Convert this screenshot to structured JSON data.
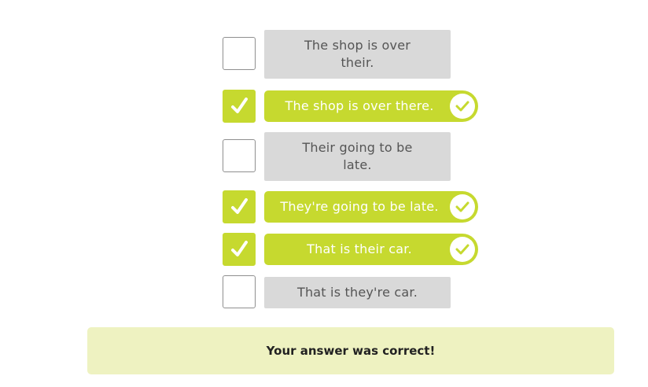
{
  "options": [
    {
      "label": "The shop is over their.",
      "checked": false
    },
    {
      "label": "The shop is over there.",
      "checked": true
    },
    {
      "label": "Their going to be late.",
      "checked": false
    },
    {
      "label": "They're going to be late.",
      "checked": true
    },
    {
      "label": "That is their car.",
      "checked": true
    },
    {
      "label": "That is they're car.",
      "checked": false
    }
  ],
  "feedback": {
    "message": "Your answer was correct!"
  },
  "colors": {
    "accent": "#c6d92f",
    "option_bg": "#d9d9d9",
    "option_text": "#555555",
    "feedback_bg": "#eef2c1"
  },
  "icons": {
    "checkbox_checked": "checkmark-icon",
    "selected_badge": "check-circle-icon"
  }
}
